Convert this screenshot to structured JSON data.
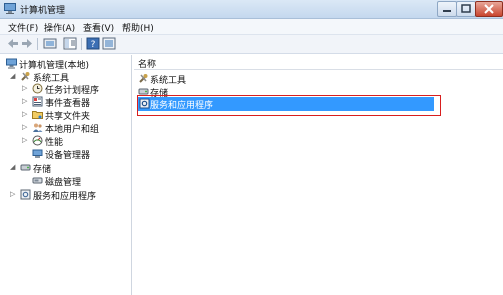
{
  "window": {
    "title": "计算机管理"
  },
  "menu": [
    {
      "label": "文件(F)"
    },
    {
      "label": "操作(A)"
    },
    {
      "label": "查看(V)"
    },
    {
      "label": "帮助(H)"
    }
  ],
  "toolbar": [
    "back-icon",
    "forward-icon",
    "up-icon",
    "show-hide-tree-icon",
    "help-icon",
    "properties-icon"
  ],
  "tree": {
    "root": "计算机管理(本地)",
    "nodes": [
      {
        "label": "系统工具",
        "icon": "tools-icon",
        "level": 1,
        "expanded": true
      },
      {
        "label": "任务计划程序",
        "icon": "clock-icon",
        "level": 2
      },
      {
        "label": "事件查看器",
        "icon": "event-viewer-icon",
        "level": 2
      },
      {
        "label": "共享文件夹",
        "icon": "shared-folder-icon",
        "level": 2
      },
      {
        "label": "本地用户和组",
        "icon": "users-icon",
        "level": 2
      },
      {
        "label": "性能",
        "icon": "performance-icon",
        "level": 2
      },
      {
        "label": "设备管理器",
        "icon": "device-manager-icon",
        "level": 2
      },
      {
        "label": "存储",
        "icon": "storage-icon",
        "level": 1,
        "expanded": true
      },
      {
        "label": "磁盘管理",
        "icon": "disk-icon",
        "level": 2
      },
      {
        "label": "服务和应用程序",
        "icon": "services-icon",
        "level": 1,
        "expanded": false
      }
    ]
  },
  "list": {
    "column": "名称",
    "items": [
      {
        "label": "系统工具",
        "icon": "tools-icon"
      },
      {
        "label": "存储",
        "icon": "storage-icon"
      },
      {
        "label": "服务和应用程序",
        "icon": "services-icon",
        "selected": true
      }
    ]
  },
  "colors": {
    "selection": "#3399ff",
    "highlight_border": "#d81e1e"
  }
}
